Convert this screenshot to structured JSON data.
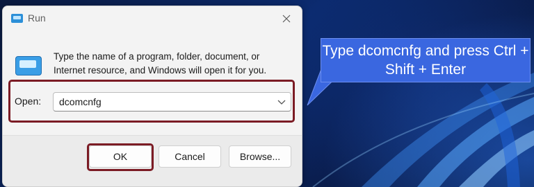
{
  "dialog": {
    "title": "Run",
    "description": "Type the name of a program, folder, document, or Internet resource, and Windows will open it for you.",
    "open_label": "Open:",
    "open_value": "dcomcnfg",
    "buttons": {
      "ok": "OK",
      "cancel": "Cancel",
      "browse": "Browse..."
    },
    "icons": {
      "title": "run-icon",
      "main": "run-icon",
      "close": "close-icon",
      "dropdown": "chevron-down-icon"
    }
  },
  "callout": {
    "text": "Type dcomcnfg and press Ctrl + Shift + Enter",
    "color": "#3a67e0"
  },
  "highlight_color": "#7b1b24"
}
